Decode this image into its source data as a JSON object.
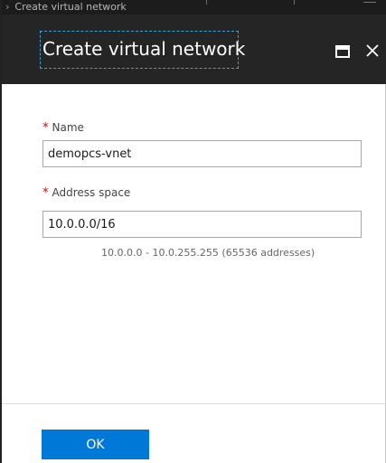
{
  "breadcrumb": {
    "chevron": "›",
    "label": "Create virtual network"
  },
  "blade": {
    "title": "Create virtual network",
    "maximize_icon": "maximize-icon",
    "close_icon": "close-icon"
  },
  "form": {
    "name": {
      "required_mark": "*",
      "label": "Name",
      "value": "demopcs-vnet"
    },
    "address_space": {
      "required_mark": "*",
      "label": "Address space",
      "value": "10.0.0.0/16",
      "hint": "10.0.0.0 - 10.0.255.255 (65536 addresses)"
    }
  },
  "footer": {
    "ok_label": "OK"
  },
  "colors": {
    "header_bg": "#252525",
    "breadcrumb_bg": "#1c1c1c",
    "accent": "#0078d7",
    "focus_outline": "#3aa0dc",
    "required": "#e00000"
  }
}
